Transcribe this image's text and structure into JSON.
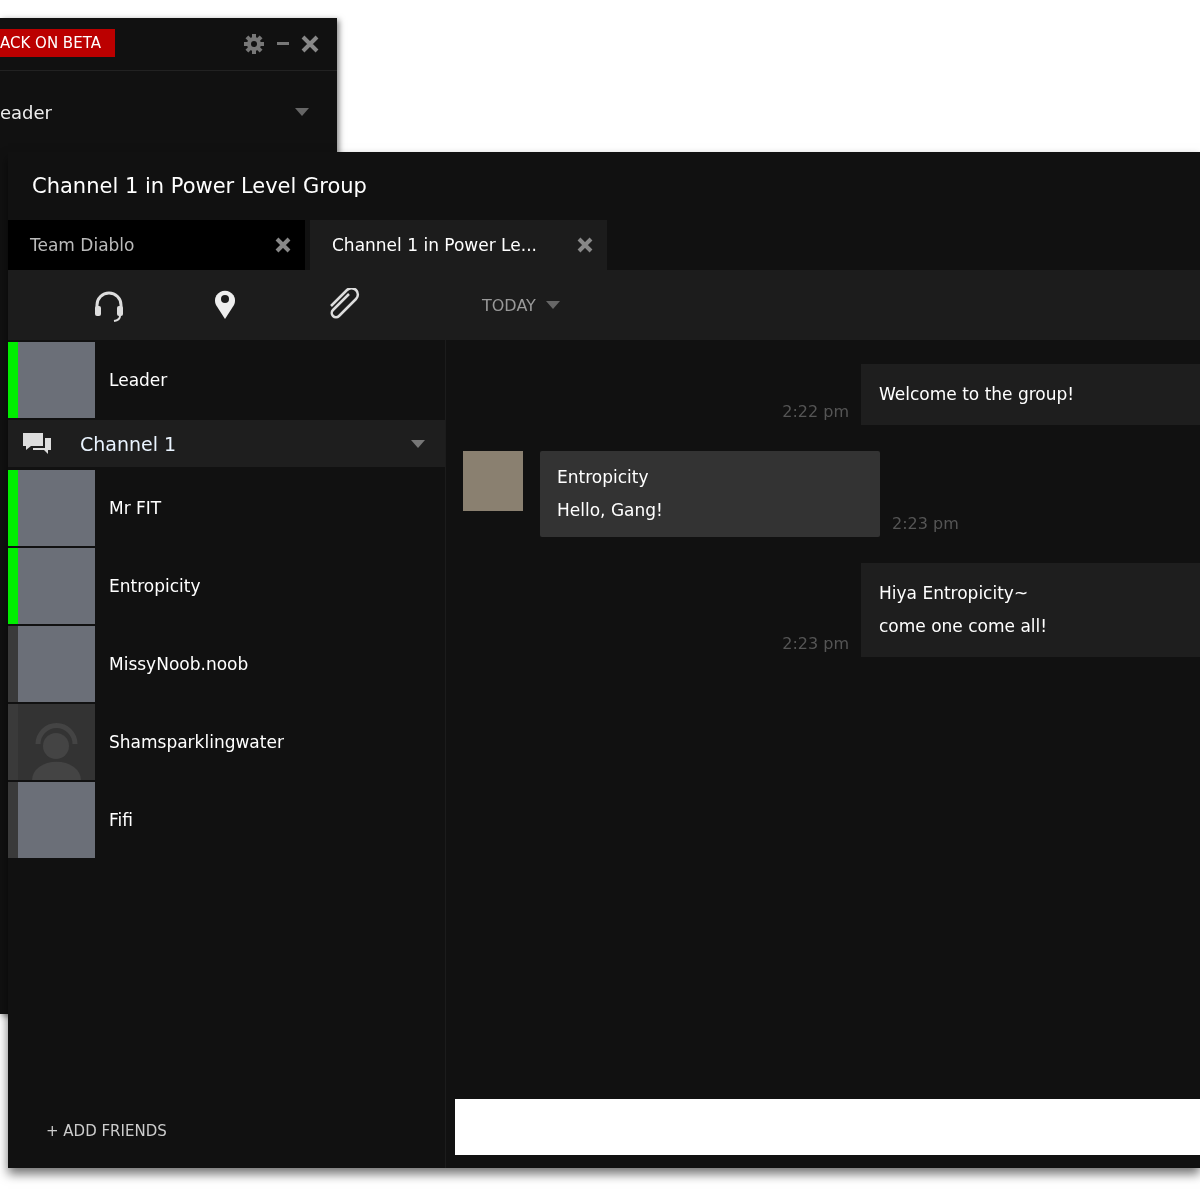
{
  "back_window": {
    "badge": "ACK ON BETA",
    "dropdown": {
      "value": "eader"
    }
  },
  "window": {
    "title": "Channel 1 in Power Level Group"
  },
  "tabs": [
    {
      "label": "Team Diablo",
      "selected": false
    },
    {
      "label": "Channel 1 in Power Le...",
      "selected": true
    }
  ],
  "toolbar": {
    "date_filter": "TODAY"
  },
  "members": [
    {
      "name": "Leader",
      "online": true,
      "kind": "photo"
    }
  ],
  "channel": {
    "name": "Channel 1",
    "expanded": true,
    "members": [
      {
        "name": "Mr FIT",
        "online": true,
        "kind": "photo"
      },
      {
        "name": "Entropicity",
        "online": true,
        "kind": "photo"
      },
      {
        "name": "MissyNoob.noob",
        "online": false,
        "kind": "photo"
      },
      {
        "name": "Shamsparklingwater",
        "online": false,
        "kind": "default"
      },
      {
        "name": "Fifi",
        "online": false,
        "kind": "photo"
      }
    ]
  },
  "add_friends": "+ ADD FRIENDS",
  "messages": [
    {
      "kind": "outgoing",
      "lines": [
        "Welcome to the group!"
      ],
      "time": "2:22 pm"
    },
    {
      "kind": "incoming",
      "sender": "Entropicity",
      "lines": [
        "Hello, Gang!"
      ],
      "time": "2:23 pm"
    },
    {
      "kind": "outgoing",
      "lines": [
        "Hiya Entropicity~",
        "come one come all!"
      ],
      "time": "2:23 pm"
    }
  ]
}
